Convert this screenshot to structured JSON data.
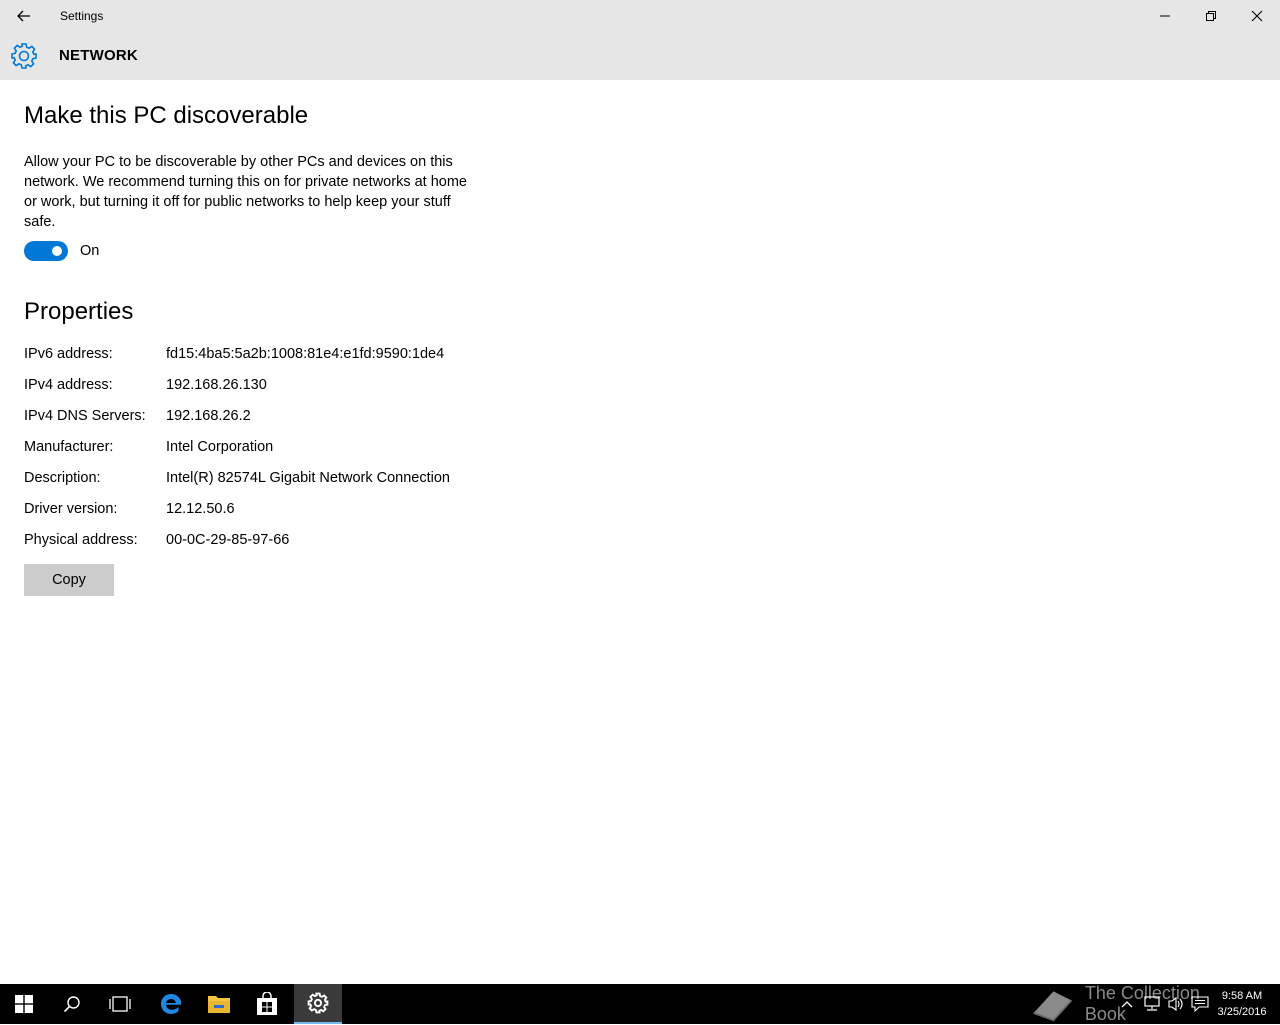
{
  "window": {
    "title": "Settings",
    "header": "NETWORK"
  },
  "discoverable": {
    "heading": "Make this PC discoverable",
    "description": "Allow your PC to be discoverable by other PCs and devices on this network. We recommend turning this on for private networks at home or work, but turning it off for public networks to help keep your stuff safe.",
    "toggle_state": "On",
    "toggle_on": true
  },
  "properties": {
    "heading": "Properties",
    "rows": [
      {
        "label": "IPv6 address:",
        "value": "fd15:4ba5:5a2b:1008:81e4:e1fd:9590:1de4"
      },
      {
        "label": "IPv4 address:",
        "value": "192.168.26.130"
      },
      {
        "label": "IPv4 DNS Servers:",
        "value": "192.168.26.2"
      },
      {
        "label": "Manufacturer:",
        "value": "Intel Corporation"
      },
      {
        "label": "Description:",
        "value": "Intel(R) 82574L Gigabit Network Connection"
      },
      {
        "label": "Driver version:",
        "value": "12.12.50.6"
      },
      {
        "label": "Physical address:",
        "value": "00-0C-29-85-97-66"
      }
    ],
    "copy_label": "Copy"
  },
  "taskbar": {
    "items": [
      "start-icon",
      "search-icon",
      "task-view-icon",
      "edge-icon",
      "file-explorer-icon",
      "store-icon",
      "settings-icon"
    ],
    "active_item": "settings-icon",
    "watermark": "The Collection Book",
    "clock_time": "9:58 AM",
    "clock_date": "3/25/2016"
  },
  "colors": {
    "accent": "#0078d7",
    "titlebar": "#e6e6e6",
    "button": "#cccccc",
    "taskbar": "#000000"
  }
}
